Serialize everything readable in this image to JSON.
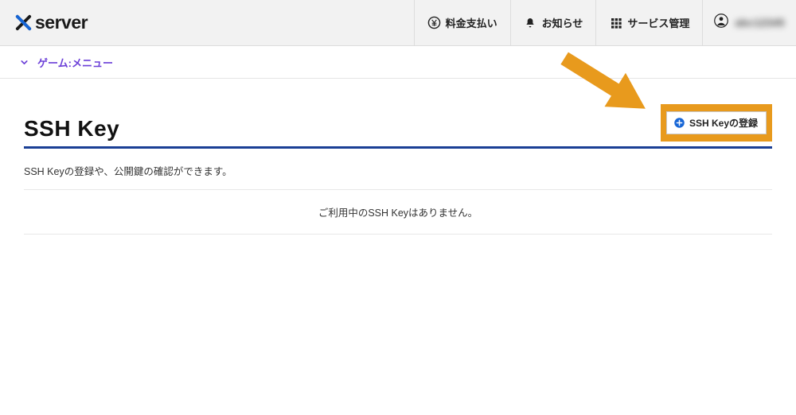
{
  "brand": {
    "name": "server"
  },
  "header": {
    "pay": "料金支払い",
    "news": "お知らせ",
    "services": "サービス管理",
    "account_id": "abc12345"
  },
  "submenu": {
    "label": "ゲーム:メニュー"
  },
  "page": {
    "title": "SSH Key",
    "register_button": "SSH Keyの登録",
    "description": "SSH Keyの登録や、公開鍵の確認ができます。",
    "empty": "ご利用中のSSH Keyはありません。"
  },
  "colors": {
    "accent": "#1a3f95",
    "highlight": "#e89a1d",
    "link": "#6b3fd8"
  }
}
